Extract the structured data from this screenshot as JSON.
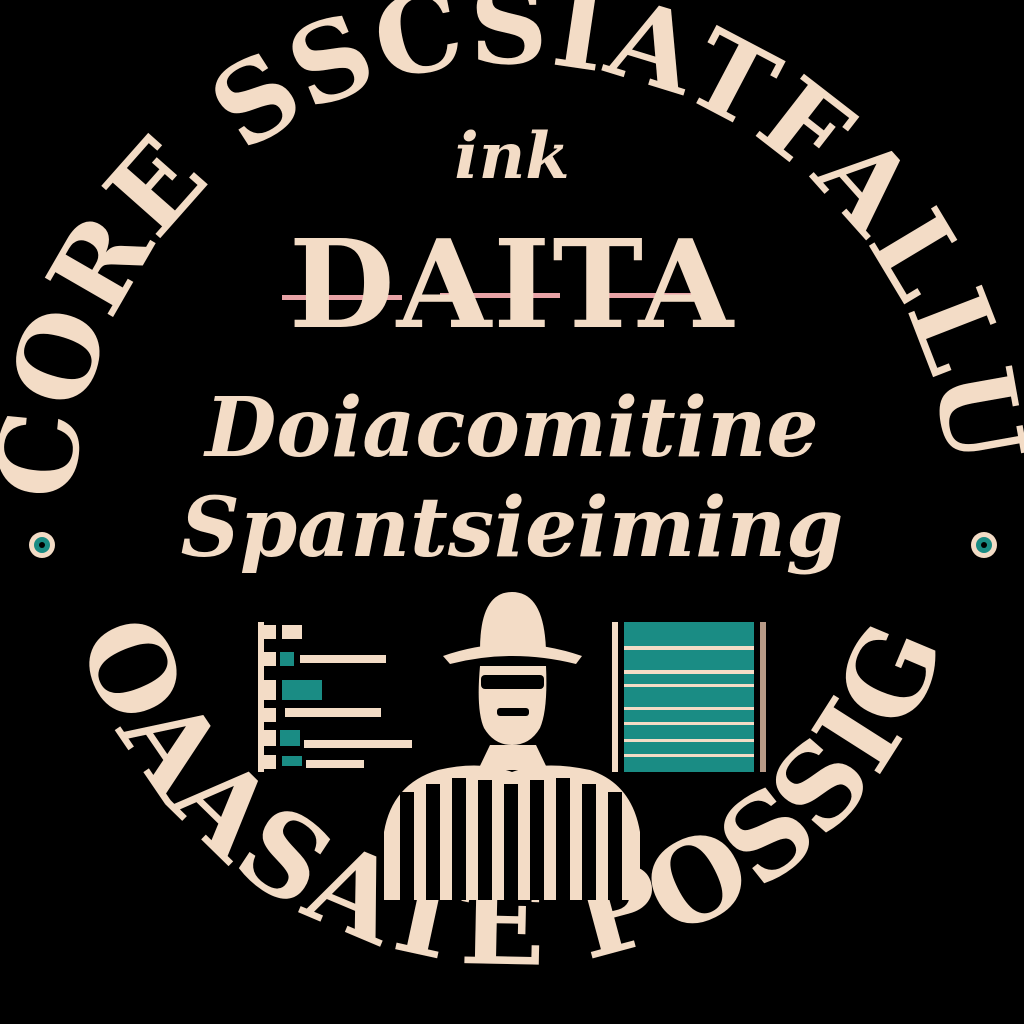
{
  "emblem": {
    "arc_top": "ESCORE SSCSIATFALLUNG",
    "arc_bottom": "OOAASATE POSSIGN",
    "word_ink": "ink",
    "word_data": "DAITA",
    "word_line1": "Doiacomitine",
    "word_line2": "Spantsieiming"
  },
  "icons": {
    "left_medallion": "medallion-icon",
    "right_medallion": "medallion-icon",
    "figure": "person-with-hat-icon",
    "left_panel": "data-table-icon",
    "right_panel": "stacked-bars-icon"
  },
  "colors": {
    "background": "#000000",
    "ink": "#f3dcc6",
    "accent_teal": "#1a8c84",
    "accent_pink": "#e8a3a6"
  }
}
